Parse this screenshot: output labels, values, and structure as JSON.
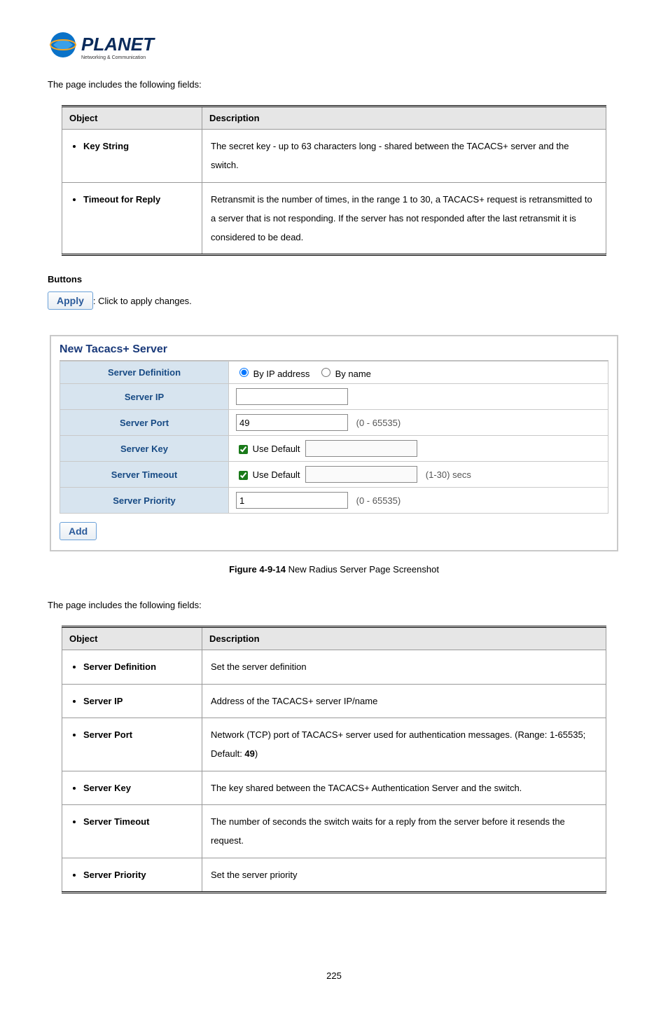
{
  "logo": {
    "brand": "PLANET",
    "tagline": "Networking & Communication"
  },
  "intro1": "The page includes the following fields:",
  "table1": {
    "head_obj": "Object",
    "head_desc": "Description",
    "rows": [
      {
        "obj": "Key String",
        "desc": "The secret key - up to 63 characters long - shared between the TACACS+ server and the switch."
      },
      {
        "obj": "Timeout for Reply",
        "desc": "Retransmit is the number of times, in the range 1 to 30, a TACACS+ request is retransmitted to a server that is not responding. If the server has not responded after the last retransmit it is considered to be dead."
      }
    ]
  },
  "buttons_title": "Buttons",
  "apply_btn": "Apply",
  "apply_text": ": Click to apply changes.",
  "panel": {
    "title": "New Tacacs+ Server",
    "rows": {
      "server_def": "Server Definition",
      "server_def_r1": "By IP address",
      "server_def_r2": "By name",
      "server_ip": "Server IP",
      "server_ip_value": "",
      "server_port": "Server Port",
      "server_port_value": "49",
      "server_port_range": "(0 - 65535)",
      "server_key": "Server Key",
      "use_default": "Use Default",
      "server_key_value": "",
      "server_timeout": "Server Timeout",
      "server_timeout_value": "",
      "server_timeout_range": "(1-30) secs",
      "server_priority": "Server Priority",
      "server_priority_value": "1",
      "server_priority_range": "(0 - 65535)"
    },
    "add_btn": "Add"
  },
  "caption": {
    "bold": "Figure 4-9-14",
    "rest": " New Radius Server Page Screenshot"
  },
  "intro2": "The page includes the following fields:",
  "table2": {
    "head_obj": "Object",
    "head_desc": "Description",
    "rows": [
      {
        "obj": "Server Definition",
        "desc": "Set the server definition"
      },
      {
        "obj": "Server IP",
        "desc": "Address of the TACACS+ server IP/name"
      },
      {
        "obj": "Server Port",
        "desc_part1": "Network (TCP) port of TACACS+ server used for authentication messages. (Range: 1-65535; Default: ",
        "desc_bold": "49",
        "desc_part2": ")"
      },
      {
        "obj": "Server Key",
        "desc": "The key shared between the TACACS+ Authentication Server and the switch."
      },
      {
        "obj": "Server Timeout",
        "desc": "The number of seconds the switch waits for a reply from the server before it resends the request."
      },
      {
        "obj": "Server Priority",
        "desc": "Set the server priority"
      }
    ]
  },
  "page_num": "225"
}
